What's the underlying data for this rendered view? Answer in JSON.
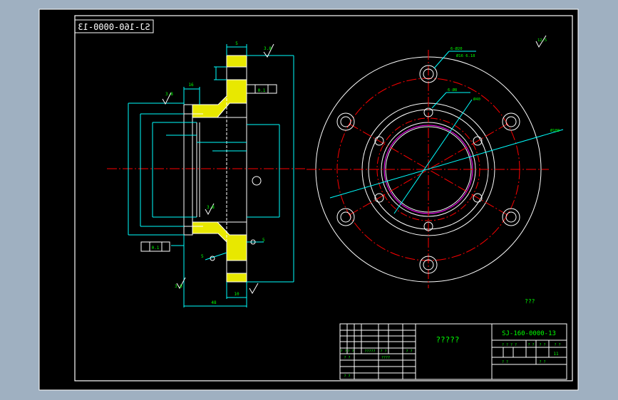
{
  "drawing": {
    "mirrored_code": "SJ-160-0000-13",
    "stamp_code": "SJ-160-0000-13",
    "title_placeholder": "?????",
    "note": "???",
    "sheet_count": "11"
  },
  "colors": {
    "background": "#9fb0c1",
    "sheet": "#000000",
    "frame": "#ffffff",
    "geometry": "#ffffff",
    "dimension": "#00ffff",
    "centerline": "#ff0000",
    "section_fill": "#e8e800",
    "text": "#00ff00",
    "highlight": "#ff00ff"
  },
  "section_view": {
    "dims": {
      "top_5": "5",
      "left_16": "16",
      "flatness_left": "3.8",
      "flatness_top": "3.8",
      "flatness_bottom": "3.8",
      "tol_a": "0.1",
      "tol_b": "0.1",
      "bottom_48": "48",
      "bottom_10": "10",
      "side_5a": "5",
      "side_5b": "5",
      "rough_bottom": "3.8"
    }
  },
  "front_view": {
    "labels": {
      "holes_outer": "6-Ø20",
      "holes_outer2": "Ø16 6.18",
      "holes_inner": "6-Ø8",
      "pitch_inner": "Ø40",
      "od": "Ø180",
      "roughness_corner": "12.5"
    }
  },
  "title_block": {
    "code": "SJ-160-0000-13",
    "name": "?????",
    "cells": [
      "? ? ? ?",
      "? ?",
      "? ?",
      "? ?",
      "? ?",
      "? ?",
      "?????",
      "? ?",
      "? ?",
      "? ?",
      "? ?",
      "? ?",
      "????",
      "? ?"
    ]
  }
}
